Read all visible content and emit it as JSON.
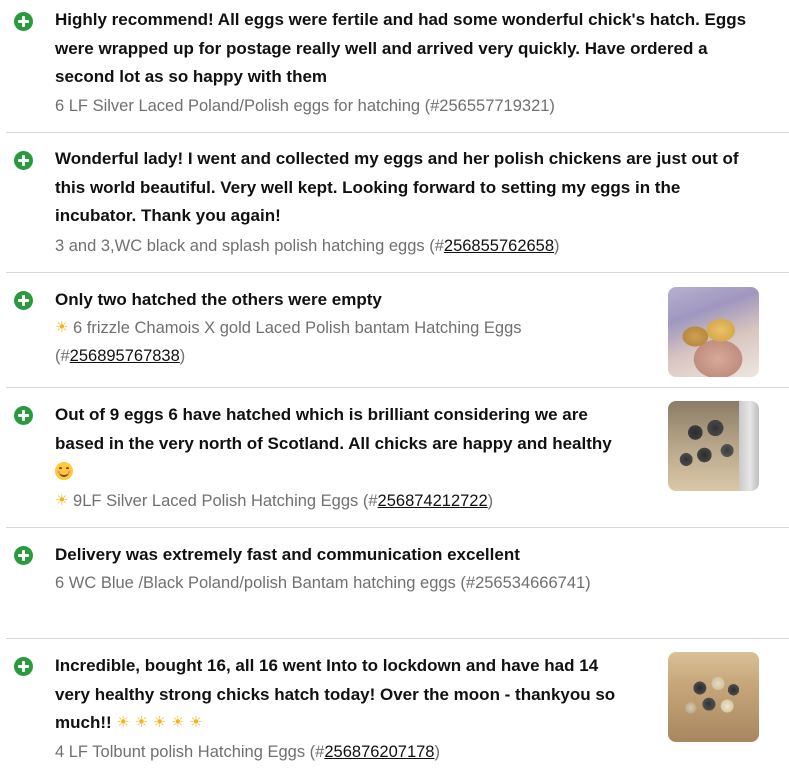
{
  "colors": {
    "positive_green": "#2b9a3e",
    "comment_text": "#111111",
    "item_text": "#707070",
    "divider": "#d9d9d9"
  },
  "reviews": [
    {
      "icon": "plus-circle-icon",
      "comment_lines": [
        "Highly recommend! All eggs were fertile and had some wonderful chick's hatch. Eggs",
        "were wrapped up for postage really well and arrived very quickly. Have ordered a",
        "second lot as so happy with them"
      ],
      "item_text": "6 LF Silver Laced Poland/Polish eggs for hatching (#256557719321)"
    },
    {
      "icon": "plus-circle-icon",
      "comment_lines": [
        "Wonderful lady! I went and collected my eggs and her polish chickens are just out of",
        "this world beautiful. Very well kept. Looking forward to setting my eggs in the",
        "incubator. Thank you again!"
      ],
      "item_prefix": "3 and 3,WC black and splash polish hatching eggs (#",
      "item_number": "256855762658",
      "item_suffix": ")"
    },
    {
      "icon": "plus-circle-icon",
      "comment_lines": [
        "Only two hatched the others were empty"
      ],
      "item_prefix": "6 frizzle Chamois X gold Laced Polish bantam Hatching Eggs",
      "item_prefix_line2": "(#",
      "item_number": "256895767838",
      "item_suffix": ")",
      "sun_icon": "☀",
      "thumbnail": "chicks-in-hand-photo"
    },
    {
      "icon": "plus-circle-icon",
      "comment_lines": [
        "Out of 9 eggs 6 have hatched which is brilliant considering we are",
        "based in the very north of Scotland. All chicks are happy and healthy"
      ],
      "emoji": "smiling-face-icon",
      "item_prefix": "9LF Silver Laced Polish Hatching Eggs (#",
      "item_number": "256874212722",
      "item_suffix": ")",
      "sun_icon": "☀",
      "thumbnail": "chicks-in-brooder-photo"
    },
    {
      "icon": "plus-circle-icon",
      "comment_lines": [
        "Delivery was extremely fast and communication excellent"
      ],
      "item_text": "6 WC Blue /Black Poland/polish Bantam hatching eggs (#256534666741)"
    },
    {
      "icon": "plus-circle-icon",
      "comment_lines": [
        "Incredible, bought 16, all 16 went Into to lockdown and have had 14",
        "very healthy strong chicks hatch today! Over the moon - thankyou so",
        "much!!"
      ],
      "sun_icons": [
        "☀",
        "☀",
        "☀",
        "☀",
        "☀"
      ],
      "item_prefix": "4 LF Tolbunt polish Hatching Eggs (#",
      "item_number": "256876207178",
      "item_suffix": ")",
      "thumbnail": "chicks-in-box-photo"
    }
  ]
}
